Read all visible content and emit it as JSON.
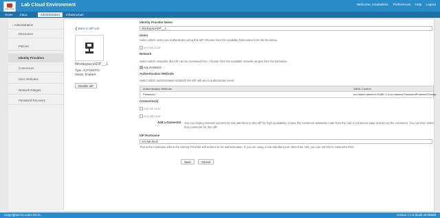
{
  "header": {
    "logo_text": "LAB LOCAL",
    "title": "Lab Cloud Environment",
    "nav": [
      "Welcome, localadmin.",
      "Preferences",
      "Help",
      "Logout"
    ]
  },
  "tabs": [
    {
      "label": "Home",
      "active": false
    },
    {
      "label": "Inbox",
      "active": false
    },
    {
      "label": "Administration",
      "active": true
    },
    {
      "label": "Infrastructure",
      "active": false
    }
  ],
  "sidebar": {
    "items": [
      {
        "label": "› Administration",
        "active": false,
        "head": true
      },
      {
        "label": "Directories",
        "active": false
      },
      {
        "label": "Policies",
        "active": false
      },
      {
        "label": "Identity Providers",
        "active": true
      },
      {
        "label": "Connectors",
        "active": false
      },
      {
        "label": "User Attributes",
        "active": false
      },
      {
        "label": "Network Ranges",
        "active": false
      },
      {
        "label": "Password Recovery",
        "active": false
      }
    ]
  },
  "left": {
    "back_link": "❮ Back to IdP List",
    "idp_name": "WorkspaceIDP__1",
    "type_line": "Type: AUTOMATIC",
    "status_line": "Status: Enabled",
    "disable_button": "Disable IdP"
  },
  "form": {
    "idp_name_label": "Identity Provider Name",
    "idp_name_value": "WorkspaceIDP__1",
    "users_label": "Users",
    "users_help": "Select which users can authenticate using this IdP. Choose from the available Directories from the list below.",
    "users_option": "vmrl.lab.local",
    "network_label": "Network",
    "network_help": "Select which networks this IdP can be accessed from. Choose from the available network ranges from the list below.",
    "network_option": "ALL RANGES",
    "auth_label": "Authentication Methods",
    "auth_help": "Select which authentication methods the IdP will use to authenticate users.",
    "auth_table": {
      "columns": [
        "Authentication Methods",
        "SAML Context"
      ],
      "rows": [
        [
          "Password",
          "urn:oasis:names:tc:SAML:2.0:ac:classes:PasswordProtectedTransp..."
        ]
      ]
    },
    "connectors_label": "Connector(s)",
    "connectors": [
      "vrgn.lab.local",
      "vrvp.lab.local"
    ],
    "add_connector_label": "Add a Connector",
    "add_connector_help_1": "You can deploy external connectors and add them to this IdP for high availability. Create the connector activation code from the Add a Connector page and set up the connector. You can then select",
    "add_connector_help_2": "that connector for this IdP.",
    "hostname_label": "IdP Hostname",
    "hostname_value": "vrsi.lab.local",
    "hostname_help": "This is the hostname where the Identity Provider will redirect to for authentication. If you are using a non-standard port other than 443, you can set this to Hostname:Port",
    "save_button": "Save",
    "cancel_button": "Cancel"
  },
  "footer": {
    "copyright": "Copyrighted to LAB LOCAL",
    "version": "version 7.1.0 (build 4270859)"
  }
}
